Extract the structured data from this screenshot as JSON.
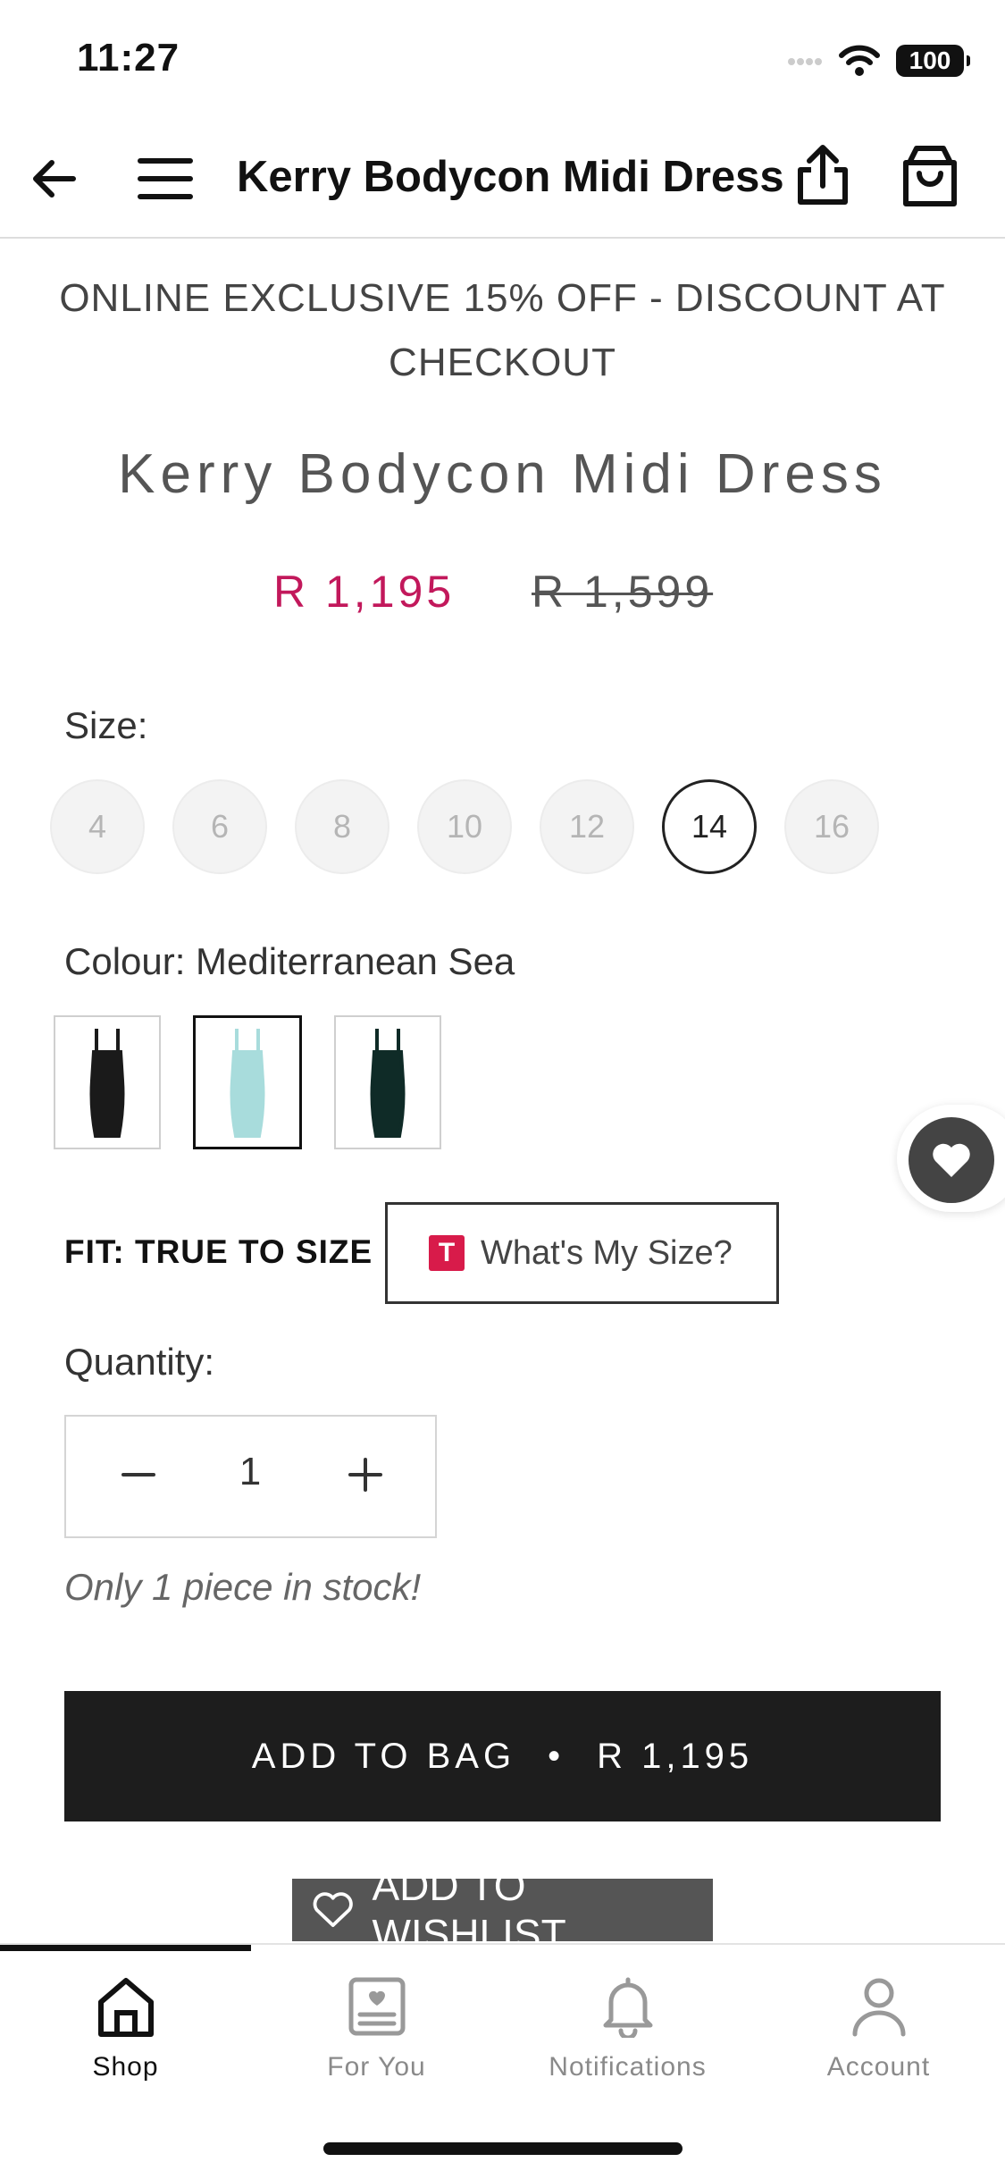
{
  "status_bar": {
    "time": "11:27",
    "battery": "100"
  },
  "header": {
    "title": "Kerry Bodycon Midi Dress"
  },
  "promo": {
    "line1": "ONLINE EXCLUSIVE 15% OFF - DISCOUNT AT",
    "line2": "CHECKOUT"
  },
  "product": {
    "title": "Kerry Bodycon Midi Dress",
    "price_sale": "R 1,195",
    "price_original": "R 1,599"
  },
  "size": {
    "label": "Size:",
    "options": [
      "4",
      "6",
      "8",
      "10",
      "12",
      "14",
      "16"
    ],
    "selected": "14"
  },
  "colour": {
    "label": "Colour: Mediterranean Sea",
    "swatches": [
      {
        "name": "black",
        "color": "#1a1a1a"
      },
      {
        "name": "mediterranean-sea",
        "color": "#a8dcdc"
      },
      {
        "name": "dark-green",
        "color": "#0f2b27"
      }
    ],
    "selected_index": 1
  },
  "fit": {
    "label": "FIT: TRUE TO SIZE",
    "size_button": "What's My Size?",
    "logo_letter": "T"
  },
  "quantity": {
    "label": "Quantity:",
    "value": "1"
  },
  "stock": {
    "text": "Only 1 piece in stock!"
  },
  "add_to_bag": {
    "label": "ADD TO BAG",
    "separator": "•",
    "price": "R 1,195"
  },
  "wishlist": {
    "label": "ADD TO WISHLIST"
  },
  "tabbar": {
    "tabs": [
      {
        "label": "Shop",
        "icon": "home-icon",
        "active": true
      },
      {
        "label": "For You",
        "icon": "for-you-icon",
        "active": false
      },
      {
        "label": "Notifications",
        "icon": "bell-icon",
        "active": false
      },
      {
        "label": "Account",
        "icon": "person-icon",
        "active": false
      }
    ]
  },
  "colors": {
    "accent_sale": "#c2185b",
    "button_dark": "#1d1d1d",
    "fit_logo": "#d81b4a"
  }
}
